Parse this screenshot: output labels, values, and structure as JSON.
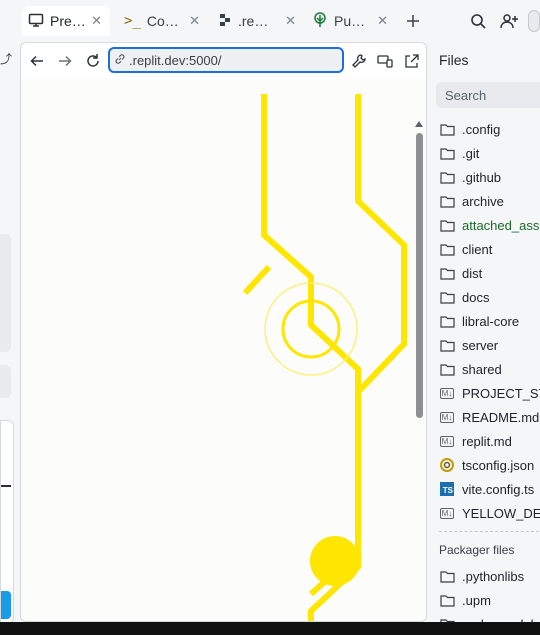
{
  "tabs": [
    {
      "label": "Pre…",
      "icon": "monitor-icon",
      "active": true
    },
    {
      "label": "Co…",
      "icon": "terminal-icon",
      "active": false
    },
    {
      "label": ".re…",
      "icon": "replit-icon",
      "active": false
    },
    {
      "label": "Pu…",
      "icon": "tree-icon",
      "active": false
    }
  ],
  "webview": {
    "url": ".replit.dev:5000/"
  },
  "files": {
    "title": "Files",
    "search_placeholder": "Search",
    "items": [
      {
        "name": ".config",
        "type": "folder"
      },
      {
        "name": ".git",
        "type": "folder"
      },
      {
        "name": ".github",
        "type": "folder"
      },
      {
        "name": "archive",
        "type": "folder"
      },
      {
        "name": "attached_ass",
        "type": "folder",
        "status": "new"
      },
      {
        "name": "client",
        "type": "folder"
      },
      {
        "name": "dist",
        "type": "folder"
      },
      {
        "name": "docs",
        "type": "folder"
      },
      {
        "name": "libral-core",
        "type": "folder"
      },
      {
        "name": "server",
        "type": "folder"
      },
      {
        "name": "shared",
        "type": "folder"
      },
      {
        "name": "PROJECT_STI",
        "type": "markdown"
      },
      {
        "name": "README.md",
        "type": "markdown"
      },
      {
        "name": "replit.md",
        "type": "markdown"
      },
      {
        "name": "tsconfig.json",
        "type": "json"
      },
      {
        "name": "vite.config.ts",
        "type": "typescript"
      },
      {
        "name": "YELLOW_DES",
        "type": "markdown"
      }
    ],
    "packager_title": "Packager files",
    "packager_items": [
      {
        "name": ".pythonlibs",
        "type": "folder"
      },
      {
        "name": ".upm",
        "type": "folder"
      },
      {
        "name": "node_module",
        "type": "folder"
      }
    ]
  },
  "colors": {
    "accent": "#1a6fe0",
    "circuit_yellow": "#ffe600",
    "git_new": "#1a6b2a"
  }
}
